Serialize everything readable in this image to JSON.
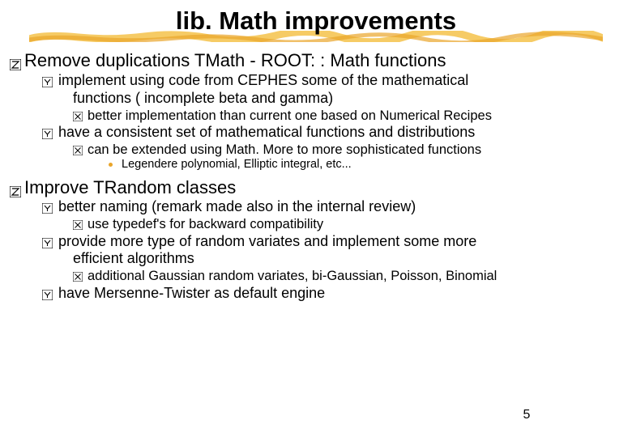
{
  "title": "lib. Math improvements",
  "page_number": "5",
  "lines": {
    "a1": "Remove duplications TMath - ROOT: : Math functions",
    "a2": "implement using code from CEPHES some of the mathematical",
    "a2b": "functions ( incomplete beta and gamma)",
    "a3": "better implementation than current one based on Numerical Recipes",
    "a4": "have a consistent set of mathematical functions and distributions",
    "a5": "can be extended using Math. More to more sophisticated functions",
    "a6": "Legendere polynomial, Elliptic integral, etc...",
    "b1": "Improve TRandom classes",
    "b2": "better naming (remark made also in the internal review)",
    "b3": "use typedef's for backward compatibility",
    "b4": "provide more type of random variates and implement some more",
    "b4b": "efficient algorithms",
    "b5": "additional Gaussian random variates, bi-Gaussian, Poisson, Binomial",
    "b6": "have Mersenne-Twister as default engine"
  }
}
